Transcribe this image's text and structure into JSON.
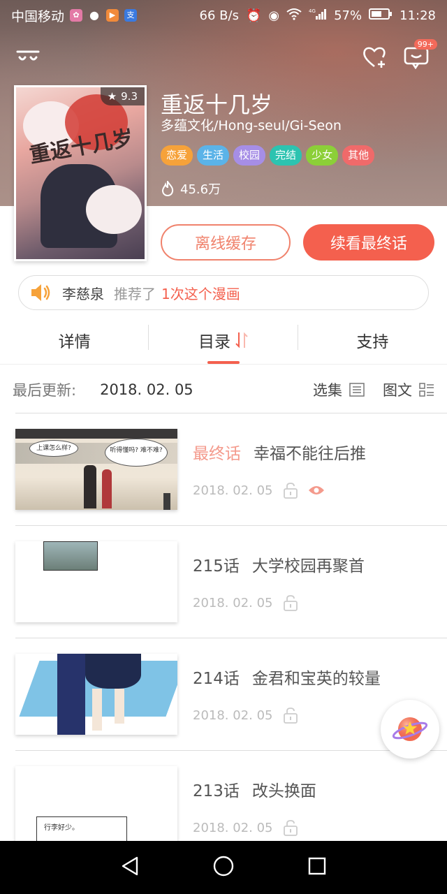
{
  "status_bar": {
    "carrier": "中国移动",
    "speed": "66 B/s",
    "battery": "57%",
    "time": "11:28",
    "network": "4G"
  },
  "header": {
    "badge_count": "99+"
  },
  "comic": {
    "title": "重返十几岁",
    "authors": "多蕴文化/Hong-seul/Gi-Seon",
    "rating": "9.3",
    "cover_art_text": "重返十几岁",
    "tags": [
      {
        "label": "恋爱",
        "color": "#f6a23a"
      },
      {
        "label": "生活",
        "color": "#5bb3e8"
      },
      {
        "label": "校园",
        "color": "#a68ee6"
      },
      {
        "label": "完结",
        "color": "#2cc3b0"
      },
      {
        "label": "少女",
        "color": "#8ccf38"
      },
      {
        "label": "其他",
        "color": "#f06a6a"
      }
    ],
    "popularity": "45.6万"
  },
  "actions": {
    "offline_cache": "离线缓存",
    "continue_read": "续看最终话"
  },
  "recommend": {
    "name": "李慈泉",
    "mid": "推荐了",
    "count": "1次这个漫画"
  },
  "tabs": [
    {
      "label": "详情"
    },
    {
      "label": "目录"
    },
    {
      "label": "支持"
    }
  ],
  "catalog": {
    "last_update_label": "最后更新:",
    "last_update_date": "2018. 02. 05",
    "select_label": "选集",
    "view_label": "图文"
  },
  "episodes": [
    {
      "num": "最终话",
      "title": "幸福不能往后推",
      "date": "2018. 02. 05",
      "hot": true,
      "viewed": true,
      "bubble1": "上课怎么样?",
      "bubble2": "听得懂吗? 难不难?"
    },
    {
      "num": "215话",
      "title": "大学校园再聚首",
      "date": "2018. 02. 05",
      "hot": false,
      "viewed": false
    },
    {
      "num": "214话",
      "title": "金君和宝英的较量",
      "date": "2018. 02. 05",
      "hot": false,
      "viewed": false
    },
    {
      "num": "213话",
      "title": "改头换面",
      "date": "2018. 02. 05",
      "hot": false,
      "viewed": false,
      "bubble1": "行李好少。"
    }
  ],
  "colors": {
    "accent": "#f4604e",
    "accent_light": "#f0826c"
  }
}
